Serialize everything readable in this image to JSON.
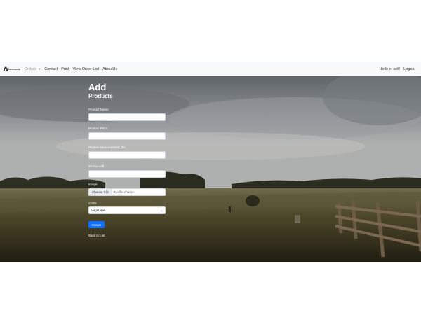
{
  "nav": {
    "brand": "farmocta",
    "items": [
      {
        "label": "Orders",
        "has_caret": true,
        "muted": true
      },
      {
        "label": "Contact"
      },
      {
        "label": "Print"
      },
      {
        "label": "View Order List"
      },
      {
        "label": "AboutUs"
      }
    ],
    "greeting": "Hello el sell!",
    "logout": "Logout"
  },
  "form": {
    "title": "Add",
    "subtitle": "Products",
    "fields": [
      {
        "label": "Product Name",
        "value": ""
      },
      {
        "label": "Product Price",
        "value": ""
      },
      {
        "label": "Product Measurement, lbs",
        "value": ""
      },
      {
        "label": "Stocks Left",
        "value": ""
      }
    ],
    "image": {
      "label": "Image",
      "button": "Choose File",
      "status": "No file chosen"
    },
    "category": {
      "label": "CatID",
      "selected": "Vegetable"
    },
    "create_label": "Create",
    "back_label": "Back to List"
  },
  "colors": {
    "navbar_bg": "#f8f9fa",
    "primary": "#0d6efd"
  }
}
